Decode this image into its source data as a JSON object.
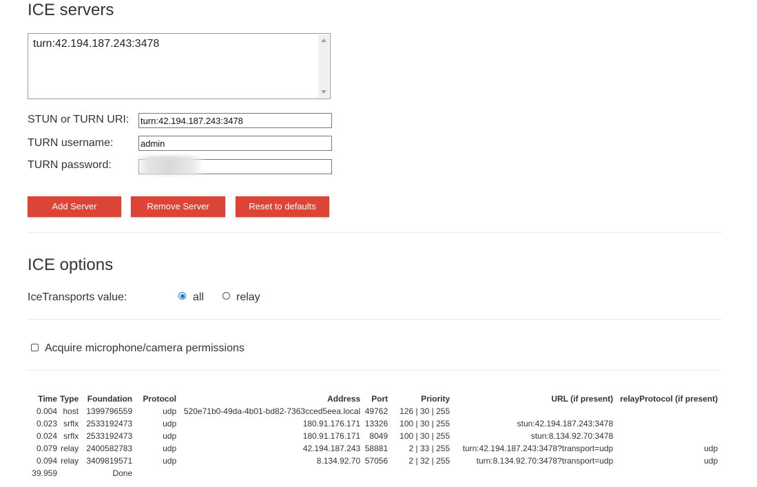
{
  "sections": {
    "ice_servers_title": "ICE servers",
    "ice_options_title": "ICE options"
  },
  "servers_list": [
    "turn:42.194.187.243:3478"
  ],
  "form": {
    "uri_label": "STUN or TURN URI:",
    "uri_value": "turn:42.194.187.243:3478",
    "username_label": "TURN username:",
    "username_value": "admin",
    "password_label": "TURN password:",
    "password_value": ""
  },
  "buttons": {
    "add": "Add Server",
    "remove": "Remove Server",
    "reset": "Reset to defaults"
  },
  "options": {
    "transports_label": "IceTransports value:",
    "radio_all": "all",
    "radio_relay": "relay",
    "selected": "all"
  },
  "permissions_label": "Acquire microphone/camera permissions",
  "accent_color": "#db4437",
  "candidates_table": {
    "headers": [
      "Time",
      "Type",
      "Foundation",
      "Protocol",
      "Address",
      "Port",
      "Priority",
      "URL (if present)",
      "relayProtocol (if present)"
    ],
    "rows": [
      [
        "0.004",
        "host",
        "1399796559",
        "udp",
        "520e71b0-49da-4b01-bd82-7363cced5eea.local",
        "49762",
        "126 | 30 | 255",
        "",
        ""
      ],
      [
        "0.023",
        "srflx",
        "2533192473",
        "udp",
        "180.91.176.171",
        "13326",
        "100 | 30 | 255",
        "stun:42.194.187.243:3478",
        ""
      ],
      [
        "0.024",
        "srflx",
        "2533192473",
        "udp",
        "180.91.176.171",
        "8049",
        "100 | 30 | 255",
        "stun:8.134.92.70:3478",
        ""
      ],
      [
        "0.079",
        "relay",
        "2400582783",
        "udp",
        "42.194.187.243",
        "58881",
        "2 | 33 | 255",
        "turn:42.194.187.243:3478?transport=udp",
        "udp"
      ],
      [
        "0.094",
        "relay",
        "3409819571",
        "udp",
        "8.134.92.70",
        "57056",
        "2 | 32 | 255",
        "turn:8.134.92.70:3478?transport=udp",
        "udp"
      ]
    ],
    "footer": [
      "39.959",
      "Done"
    ]
  }
}
